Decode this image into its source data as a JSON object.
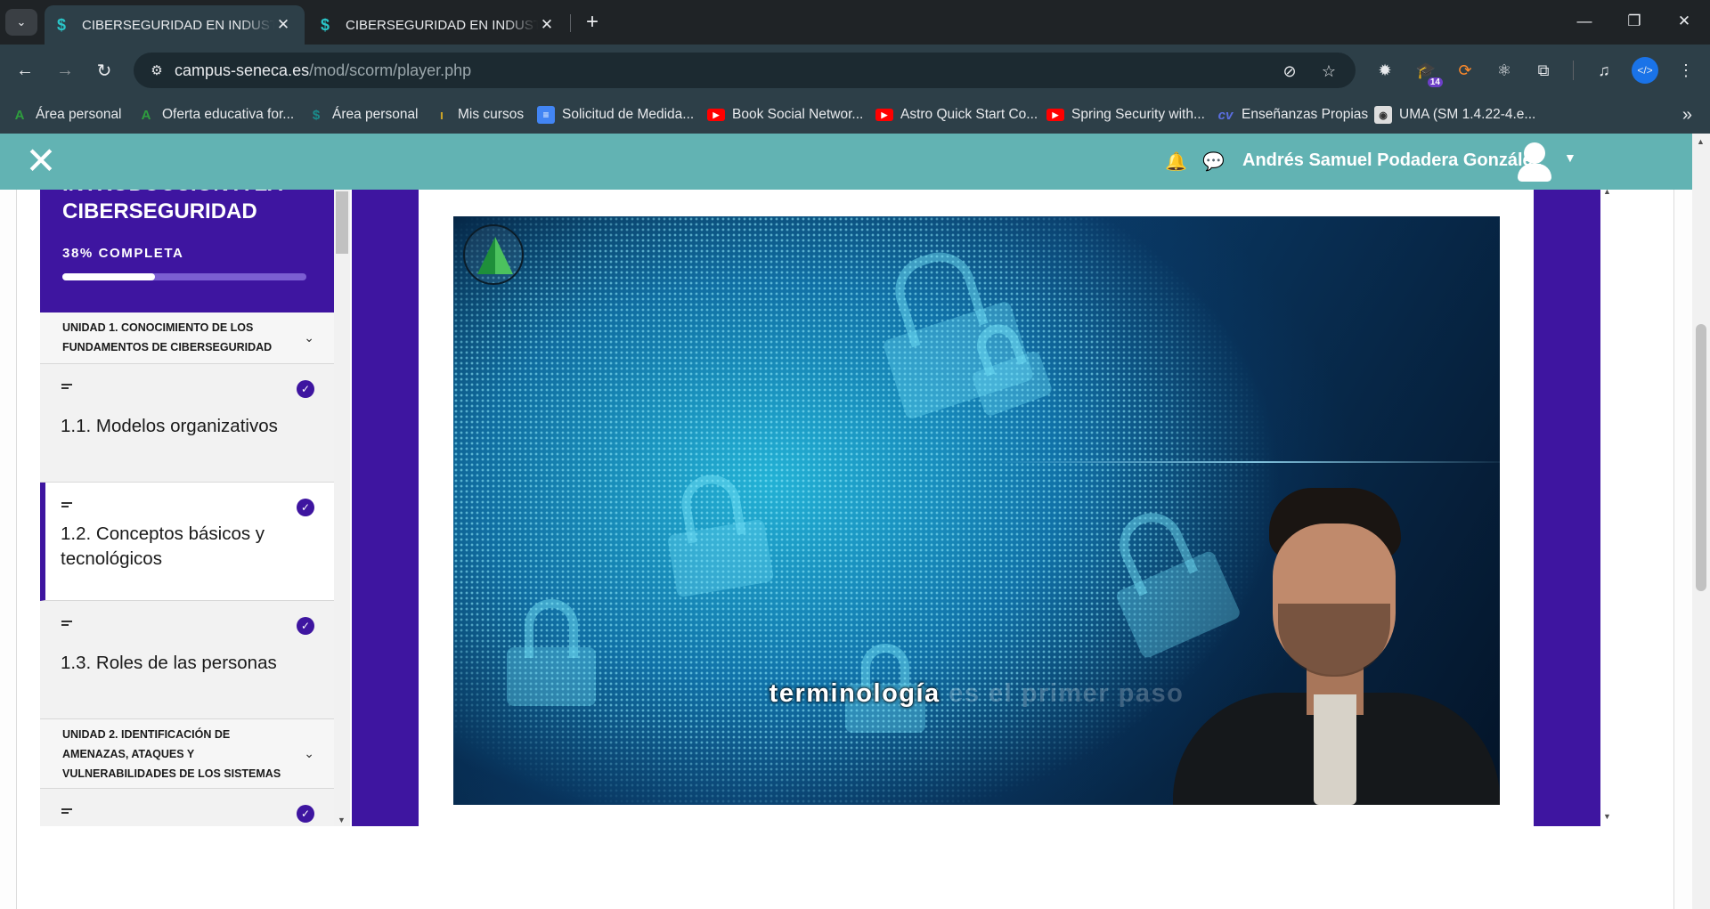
{
  "browser": {
    "tabs": [
      {
        "title": "CIBERSEGURIDAD EN INDUSTRIAS",
        "close": "✕",
        "active": true
      },
      {
        "title": "CIBERSEGURIDAD EN INDUSTRIAS",
        "close": "✕",
        "active": false
      }
    ],
    "new_tab": "+",
    "window_controls": {
      "minimize": "—",
      "restore": "❐",
      "close": "✕"
    },
    "url_host": "campus-seneca.es",
    "url_path": "/mod/scorm/player.php",
    "extension_badge": "14",
    "bookmarks": [
      {
        "label": "Área personal",
        "icon": "andalucia-logo-icon",
        "color": "#2e9e3e"
      },
      {
        "label": "Oferta educativa for...",
        "icon": "andalucia-logo-icon",
        "color": "#2e9e3e"
      },
      {
        "label": "Área personal",
        "icon": "seneca-logo-icon",
        "color": "#1a8c8c"
      },
      {
        "label": "Mis cursos",
        "icon": "moodle-logo-icon",
        "color": "#c9a227"
      },
      {
        "label": "Solicitud de Medida...",
        "icon": "google-docs-icon",
        "color": "#4285f4"
      },
      {
        "label": "Book Social Networ...",
        "icon": "youtube-icon",
        "color": "#ff0000"
      },
      {
        "label": "Astro Quick Start Co...",
        "icon": "youtube-icon",
        "color": "#ff0000"
      },
      {
        "label": "Spring Security with...",
        "icon": "youtube-icon",
        "color": "#ff0000"
      },
      {
        "label": "Enseñanzas Propias",
        "icon": "ev-logo-icon",
        "color": "#5b6ee1"
      },
      {
        "label": "UMA (SM 1.4.22-4.e...",
        "icon": "uma-logo-icon",
        "color": "#dddddd"
      }
    ]
  },
  "header": {
    "user_name": "Andrés Samuel Podadera González",
    "accent": "#62b3b3"
  },
  "sidebar": {
    "course_title": "INTRODUCCIÓN A LA CIBERSEGURIDAD",
    "progress_label": "38% COMPLETA",
    "progress": 0.38,
    "accent": "#3e15a0",
    "units": [
      {
        "title": "UNIDAD 1. CONOCIMIENTO DE LOS FUNDAMENTOS DE CIBERSEGURIDAD"
      },
      {
        "title": "UNIDAD 2. IDENTIFICACIÓN DE AMENAZAS, ATAQUES Y VULNERABILIDADES DE LOS SISTEMAS"
      }
    ],
    "lessons": [
      {
        "title": "1.1. Modelos organizativos",
        "completed": true,
        "current": false
      },
      {
        "title": "1.2. Conceptos básicos y tecnológicos",
        "completed": true,
        "current": true
      },
      {
        "title": "1.3. Roles de las personas",
        "completed": true,
        "current": false
      },
      {
        "title": "",
        "completed": true,
        "current": false
      }
    ]
  },
  "video": {
    "subtitle_spoken": "terminología",
    "subtitle_upcoming": " es el primer paso"
  }
}
